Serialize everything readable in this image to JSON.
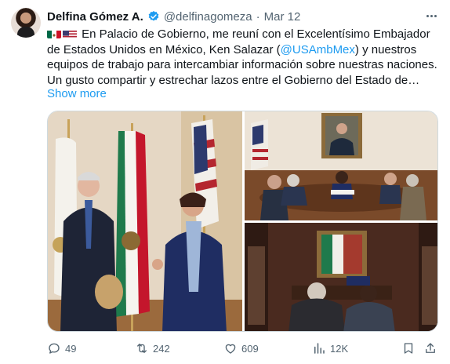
{
  "author": {
    "name": "Delfina Gómez A.",
    "handle": "@delfinagomeza",
    "separator": "·",
    "date": "Mar 12"
  },
  "tweet": {
    "line1_text": "En Palacio de Gobierno, me reuní con el Excelentísimo Embajador de Estados Unidos en México, Ken Salazar (",
    "mention": "@USAmbMex",
    "line1_rest": ") y nuestros equipos de trabajo para intercambiar información sobre nuestras naciones.",
    "line2_text": "Un gusto compartir y estrechar lazos entre el Gobierno del Estado de…",
    "show_more": "Show more"
  },
  "actions": {
    "replies": "49",
    "reposts": "242",
    "likes": "609",
    "views": "12K"
  },
  "colors": {
    "accent": "#1d9bf0",
    "muted": "#536471",
    "text": "#0f1419"
  },
  "icons": [
    "verified-badge-icon",
    "more-options-icon",
    "mexico-flag-icon",
    "usa-flag-icon",
    "reply-icon",
    "repost-icon",
    "like-icon",
    "views-icon",
    "bookmark-icon",
    "share-icon"
  ]
}
